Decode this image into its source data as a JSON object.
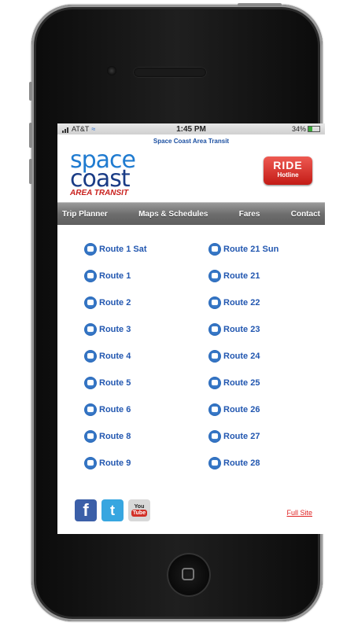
{
  "status_bar": {
    "carrier": "AT&T",
    "time": "1:45 PM",
    "battery": "34%"
  },
  "site_title": "Space Coast Area Transit",
  "logo": {
    "line1": "space",
    "line2": "coast",
    "line3": "AREA TRANSIT"
  },
  "ride_hotline": {
    "title": "RIDE",
    "subtitle": "Hotline"
  },
  "nav": {
    "items": [
      "Trip Planner",
      "Maps & Schedules",
      "Fares",
      "Contact"
    ]
  },
  "routes": {
    "left": [
      "Route 1 Sat",
      "Route 1",
      "Route 2",
      "Route 3",
      "Route 4",
      "Route 5",
      "Route 6",
      "Route 8",
      "Route 9"
    ],
    "right": [
      "Route 21 Sun",
      "Route 21",
      "Route 22",
      "Route 23",
      "Route 24",
      "Route 25",
      "Route 26",
      "Route 27",
      "Route 28"
    ]
  },
  "footer": {
    "facebook": "f",
    "twitter": "t",
    "youtube_top": "You",
    "youtube_bottom": "Tube",
    "full_site": "Full Site"
  },
  "colors": {
    "brand_blue": "#1a3c86",
    "link_blue": "#2257b0",
    "ride_red": "#c31b16",
    "nav_gray": "#6e6e6e"
  },
  "icons": [
    "bus-icon",
    "wifi-icon",
    "battery-icon",
    "facebook-icon",
    "twitter-icon",
    "youtube-icon"
  ]
}
